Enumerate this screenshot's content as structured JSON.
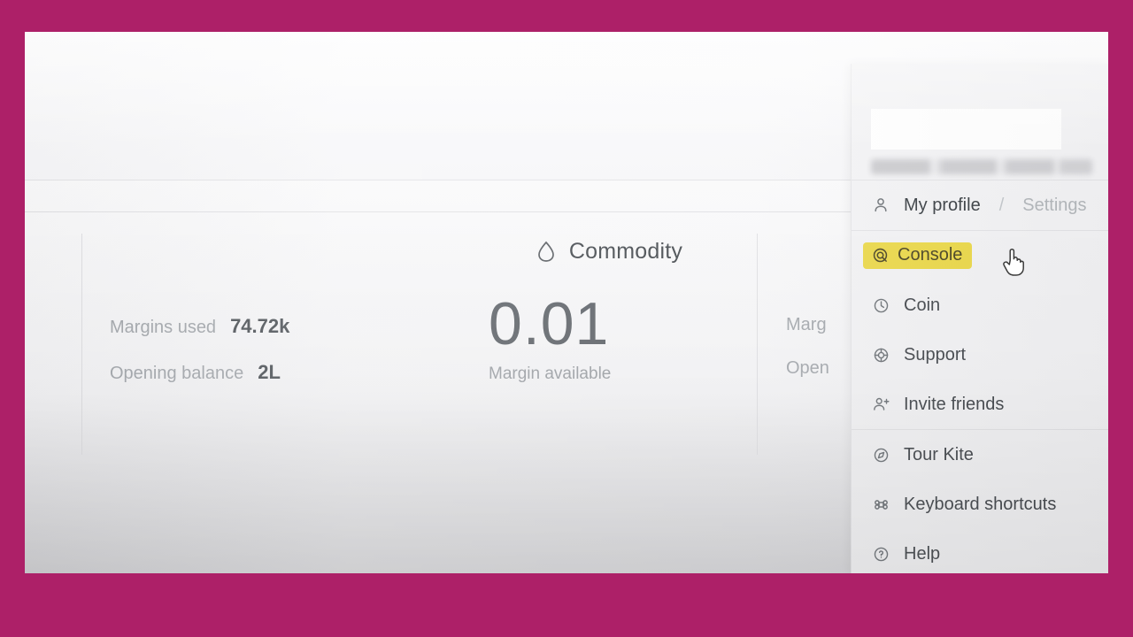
{
  "window": {
    "frame_color": "#ad2068",
    "background": "#f7f7f9"
  },
  "dashboard": {
    "segments": [
      {
        "name": "equity-segment",
        "icon": "",
        "title": "",
        "stats": [
          {
            "label": "Margins used",
            "value": "74.72k"
          },
          {
            "label": "Opening balance",
            "value": "2L"
          }
        ]
      },
      {
        "name": "commodity-segment",
        "icon": "droplet-icon",
        "title": "Commodity",
        "value": "0.01",
        "value_label": "Margin available"
      },
      {
        "name": "third-segment",
        "stats": [
          {
            "label": "Marg",
            "value": ""
          },
          {
            "label": "Open",
            "value": ""
          }
        ]
      }
    ]
  },
  "menu": {
    "user": {
      "name_redacted": "",
      "email_blurred": ""
    },
    "profile_row": {
      "icon": "person-icon",
      "label": "My profile",
      "separator": "/",
      "sub_label": "Settings"
    },
    "groups": [
      {
        "items": [
          {
            "icon": "console-circle-icon",
            "label": "Console",
            "highlighted": true,
            "highlight_color": "#ecd94a"
          },
          {
            "icon": "clock-icon",
            "label": "Coin",
            "highlighted": false
          },
          {
            "icon": "support-icon",
            "label": "Support",
            "highlighted": false
          },
          {
            "icon": "person-plus-icon",
            "label": "Invite friends",
            "highlighted": false
          }
        ]
      },
      {
        "items": [
          {
            "icon": "compass-icon",
            "label": "Tour Kite",
            "highlighted": false
          },
          {
            "icon": "command-icon",
            "label": "Keyboard shortcuts",
            "highlighted": false
          },
          {
            "icon": "help-circle-icon",
            "label": "Help",
            "highlighted": false
          }
        ]
      }
    ]
  },
  "cursor": {
    "type": "pointer-hand-cursor"
  }
}
